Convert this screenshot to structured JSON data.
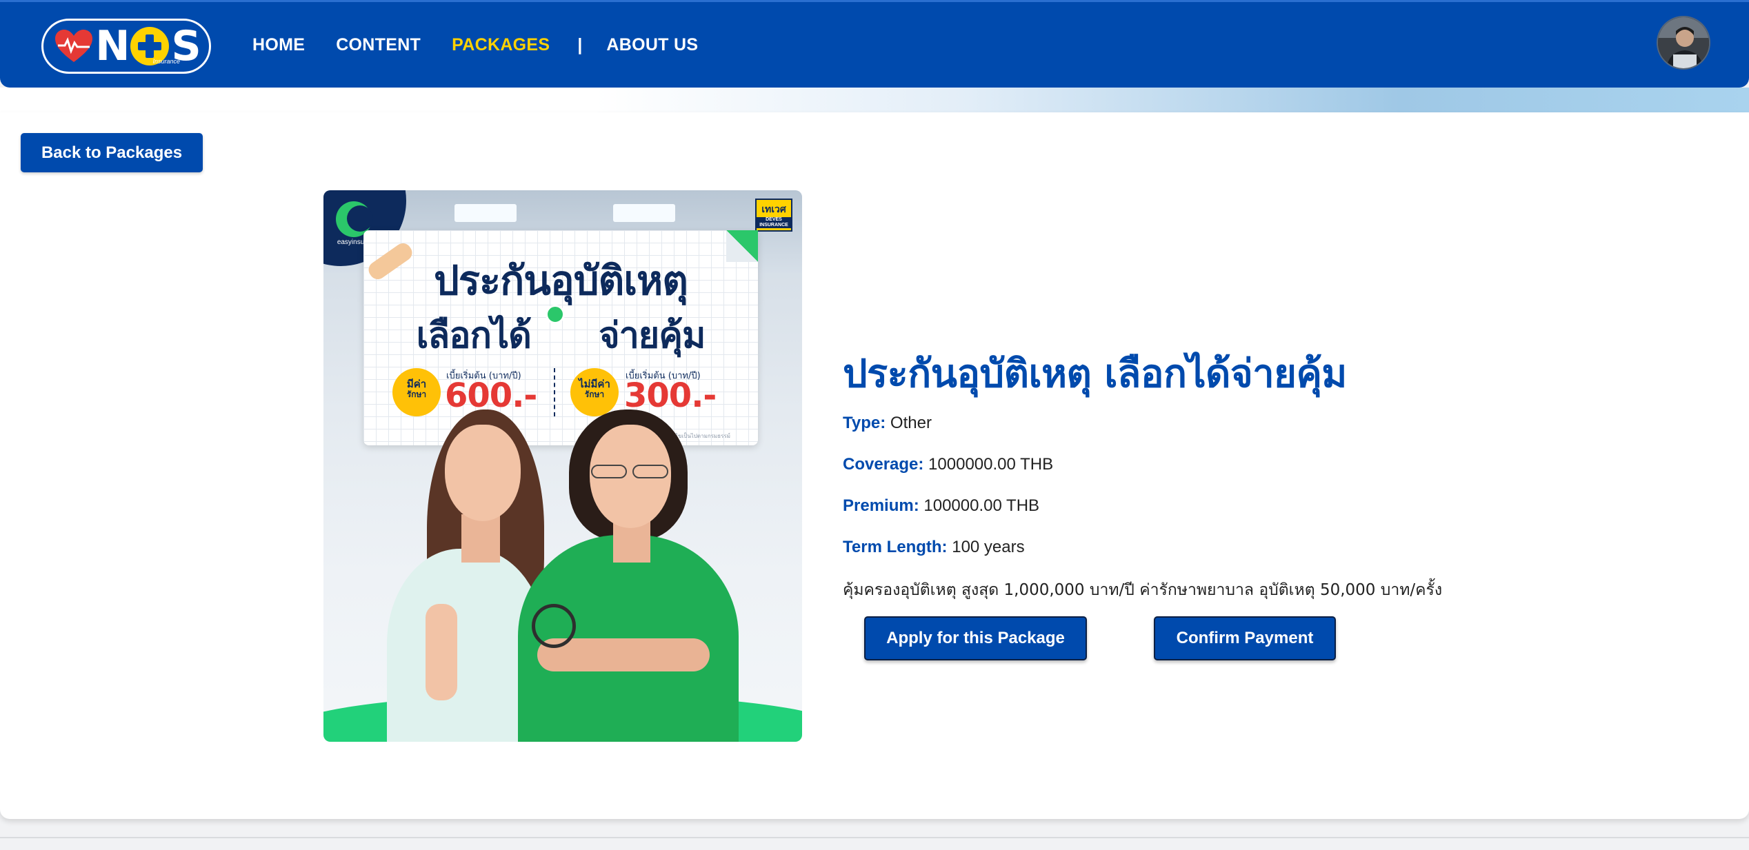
{
  "nav": {
    "logo": {
      "word_left": "N",
      "word_right": "S",
      "sub": "Insurance"
    },
    "links": [
      "HOME",
      "CONTENT",
      "PACKAGES",
      "|",
      "ABOUT US"
    ],
    "active": "PACKAGES",
    "avatar": "user-avatar"
  },
  "back_button": "Back to Packages",
  "poster": {
    "brand": "easyinsure",
    "insurer": "เทเวศ",
    "insurer_sub": "DEVES INSURANCE",
    "headline_1": "ประกันอุบัติเหตุ",
    "headline_2a": "เลือกได้",
    "headline_2b": "จ่ายคุ้ม",
    "offer_1": {
      "badge_top": "มีค่า",
      "badge_bottom": "รักษา",
      "caption": "เบี้ยเริ่มต้น (บาท/ปี)",
      "price": "600.-"
    },
    "offer_2": {
      "badge_top": "ไม่มีค่า",
      "badge_bottom": "รักษา",
      "caption": "เบี้ยเริ่มต้น (บาท/ปี)",
      "price": "300.-"
    },
    "note": "*เงื่อนไขเป็นไปตามกรมธรรม์"
  },
  "package": {
    "title": "ประกันอุบัติเหตุ เลือกได้จ่ายคุ้ม",
    "type_label": "Type:",
    "type_value": "Other",
    "coverage_label": "Coverage:",
    "coverage_value": "1000000.00 THB",
    "premium_label": "Premium:",
    "premium_value": "100000.00 THB",
    "term_label": "Term Length:",
    "term_value": "100 years",
    "description": "คุ้มครองอุบัติเหตุ สูงสุด 1,000,000 บาท/ปี ค่ารักษาพยาบาล อุบัติเหตุ 50,000 บาท/ครั้ง"
  },
  "actions": {
    "apply": "Apply for this Package",
    "confirm": "Confirm Payment"
  },
  "colors": {
    "primary": "#004aad",
    "accent_yellow": "#ffd200",
    "price_red": "#e53935",
    "green": "#22d17a"
  }
}
